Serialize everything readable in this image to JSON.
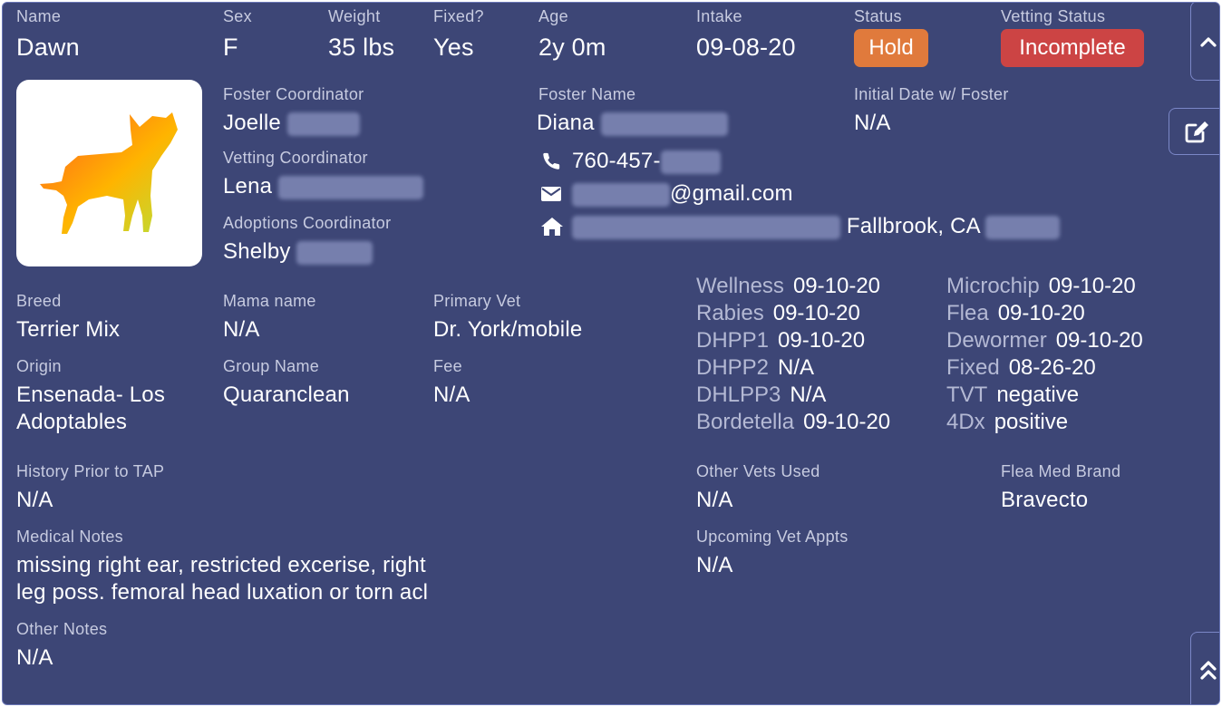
{
  "header": {
    "name_label": "Name",
    "name": "Dawn",
    "sex_label": "Sex",
    "sex": "F",
    "weight_label": "Weight",
    "weight": "35 lbs",
    "fixed_label": "Fixed?",
    "fixed": "Yes",
    "age_label": "Age",
    "age": "2y 0m",
    "intake_label": "Intake",
    "intake": "09-08-20",
    "status_label": "Status",
    "status": "Hold",
    "vetting_label": "Vetting Status",
    "vetting": "Incomplete"
  },
  "colors": {
    "card_bg": "#3d4676",
    "hold": "#e07a3c",
    "incomplete": "#cc4444"
  },
  "coordinators": {
    "foster_label": "Foster Coordinator",
    "foster": "Joelle",
    "vetting_label": "Vetting Coordinator",
    "vetting": "Lena",
    "adoptions_label": "Adoptions Coordinator",
    "adoptions": "Shelby"
  },
  "foster": {
    "name_label": "Foster Name",
    "name": "Diana",
    "phone": "760-457-",
    "email": "@gmail.com",
    "address": "Fallbrook, CA",
    "initial_label": "Initial Date w/ Foster",
    "initial": "N/A"
  },
  "details": {
    "breed_label": "Breed",
    "breed": "Terrier Mix",
    "mama_label": "Mama name",
    "mama": "N/A",
    "vet_label": "Primary Vet",
    "vet": "Dr. York/mobile",
    "origin_label": "Origin",
    "origin_1": "Ensenada- Los",
    "origin_2": "Adoptables",
    "group_label": "Group Name",
    "group": "Quaranclean",
    "fee_label": "Fee",
    "fee": "N/A"
  },
  "vaccines": {
    "left": [
      {
        "label": "Wellness",
        "value": "09-10-20"
      },
      {
        "label": "Rabies",
        "value": "09-10-20"
      },
      {
        "label": "DHPP1",
        "value": "09-10-20"
      },
      {
        "label": "DHPP2",
        "value": "N/A"
      },
      {
        "label": "DHLPP3",
        "value": "N/A"
      },
      {
        "label": "Bordetella",
        "value": "09-10-20"
      }
    ],
    "right": [
      {
        "label": "Microchip",
        "value": "09-10-20"
      },
      {
        "label": "Flea",
        "value": "09-10-20"
      },
      {
        "label": "Dewormer",
        "value": "09-10-20"
      },
      {
        "label": "Fixed",
        "value": "08-26-20"
      },
      {
        "label": "TVT",
        "value": "negative"
      },
      {
        "label": "4Dx",
        "value": "positive"
      }
    ]
  },
  "notes": {
    "history_label": "History Prior to TAP",
    "history": "N/A",
    "medical_label": "Medical Notes",
    "medical_1": "missing right ear, restricted excerise, right",
    "medical_2": "leg poss. femoral head luxation or torn acl",
    "other_label": "Other Notes",
    "other": "N/A",
    "other_vets_label": "Other Vets Used",
    "other_vets": "N/A",
    "flea_brand_label": "Flea Med Brand",
    "flea_brand": "Bravecto",
    "upcoming_label": "Upcoming Vet Appts",
    "upcoming": "N/A"
  },
  "icons": {
    "collapse": "chevron-up-icon",
    "edit": "edit-icon",
    "top": "double-chevron-up-icon",
    "phone": "phone-icon",
    "email": "envelope-icon",
    "home": "home-icon",
    "photo": "dog-photo"
  }
}
